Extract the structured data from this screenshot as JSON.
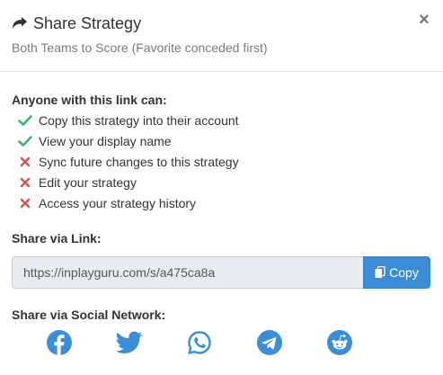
{
  "header": {
    "title": "Share Strategy",
    "subtitle": "Both Teams to Score (Favorite conceded first)",
    "close_label": "×",
    "share_icon": "share-arrow-icon"
  },
  "permissions": {
    "heading": "Anyone with this link can:",
    "items": [
      {
        "label": "Copy this strategy into their account",
        "allowed": true
      },
      {
        "label": "View your display name",
        "allowed": true
      },
      {
        "label": "Sync future changes to this strategy",
        "allowed": false
      },
      {
        "label": "Edit your strategy",
        "allowed": false
      },
      {
        "label": "Access your strategy history",
        "allowed": false
      }
    ]
  },
  "link": {
    "heading": "Share via Link:",
    "url": "https://inplayguru.com/s/a475ca8a",
    "copy_label": "Copy"
  },
  "social": {
    "heading": "Share via Social Network:",
    "networks": [
      "facebook",
      "twitter",
      "whatsapp",
      "telegram",
      "reddit"
    ]
  },
  "colors": {
    "allowed": "#3cb371",
    "denied": "#d9534f",
    "accent": "#3c8dd8",
    "social": "#3c8dd8"
  }
}
